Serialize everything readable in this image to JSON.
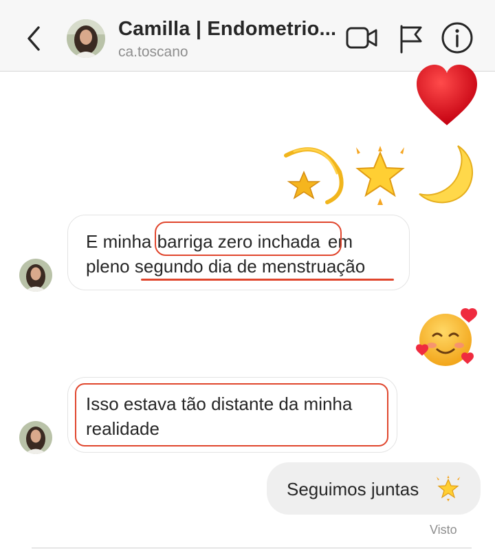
{
  "header": {
    "title": "Camilla | Endometrio...",
    "username": "ca.toscano",
    "icons": [
      "chevron-left-icon",
      "video-camera-icon",
      "flag-icon",
      "info-icon"
    ]
  },
  "messages": [
    {
      "from": "me",
      "type": "emoji",
      "content": "heart"
    },
    {
      "from": "me",
      "type": "emoji",
      "content": "dizzy shooting star, glowing star, crescent moon"
    },
    {
      "from": "them",
      "type": "text",
      "lines": [
        "E minha barriga zero inchada em",
        "pleno segundo dia de menstruação"
      ]
    },
    {
      "from": "me",
      "type": "emoji",
      "content": "smiling face with hearts"
    },
    {
      "from": "them",
      "type": "text",
      "lines": [
        "Isso estava tão distante da minha",
        "realidade"
      ]
    },
    {
      "from": "me",
      "type": "text",
      "text": "Seguimos juntas",
      "emoji": "glowing-star"
    }
  ],
  "msg1": {
    "l1_a": "E minha",
    "l1_b": "barriga zero inchada",
    "l1_c": "em",
    "l2_a": "pleno",
    "l2_b": "segundo dia de menstruação"
  },
  "msg2": {
    "l1": "Isso estava tão distante da minha",
    "l2": "realidade"
  },
  "msg3": {
    "text": "Seguimos juntas"
  },
  "status": {
    "seen": "Visto"
  },
  "colors": {
    "annotation": "#e0452c",
    "header_bg": "#f7f7f7",
    "outgoing_bubble": "#efefef"
  }
}
